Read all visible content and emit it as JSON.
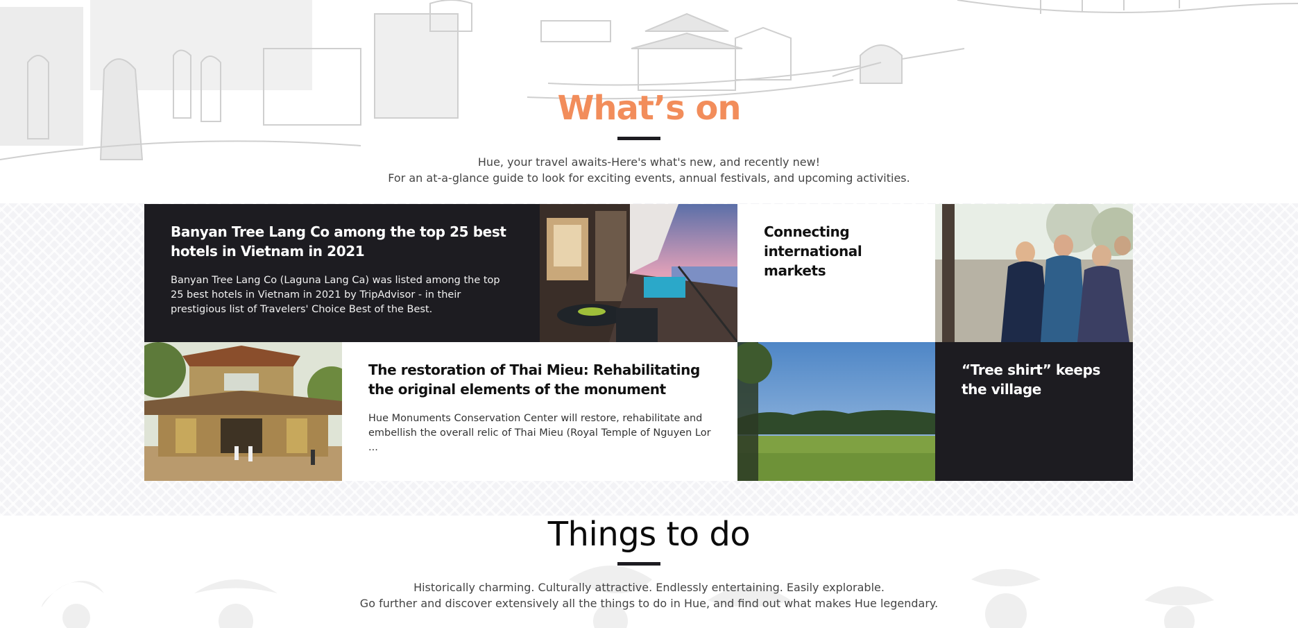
{
  "whats_on": {
    "title": "What’s on",
    "title_color": "#f28d5b",
    "intro_line1": "Hue, your travel awaits-Here's what's new, and recently new!",
    "intro_line2": "For an at-a-glance guide to look for exciting events, annual festivals, and upcoming activities."
  },
  "cards": [
    {
      "title": "Banyan Tree Lang Co among the top 25 best hotels in Vietnam in 2021",
      "text": "Banyan Tree Lang Co (Laguna Lang Ca) was listed among the top 25 best hotels in Vietnam in 2021 by TripAdvisor - in their prestigious list of Travelers' Choice Best of the Best."
    },
    {
      "title": "Connecting international markets"
    },
    {
      "title": "The restoration of Thai Mieu: Rehabilitating the original elements of the monument",
      "text": "Hue Monuments Conservation Center will restore, rehabilitate and embellish the overall relic of Thai Mieu (Royal Temple of Nguyen Lor",
      "ellipsis": "..."
    },
    {
      "title": "“Tree shirt” keeps the village"
    }
  ],
  "things_to_do": {
    "title": "Things to do",
    "intro_line1": "Historically charming. Culturally attractive. Endlessly entertaining. Easily explorable.",
    "intro_line2": "Go further and discover extensively all the things to do in Hue, and find out what makes Hue legendary."
  },
  "colors": {
    "dark_tile": "#1d1c21",
    "accent": "#f28d5b"
  }
}
